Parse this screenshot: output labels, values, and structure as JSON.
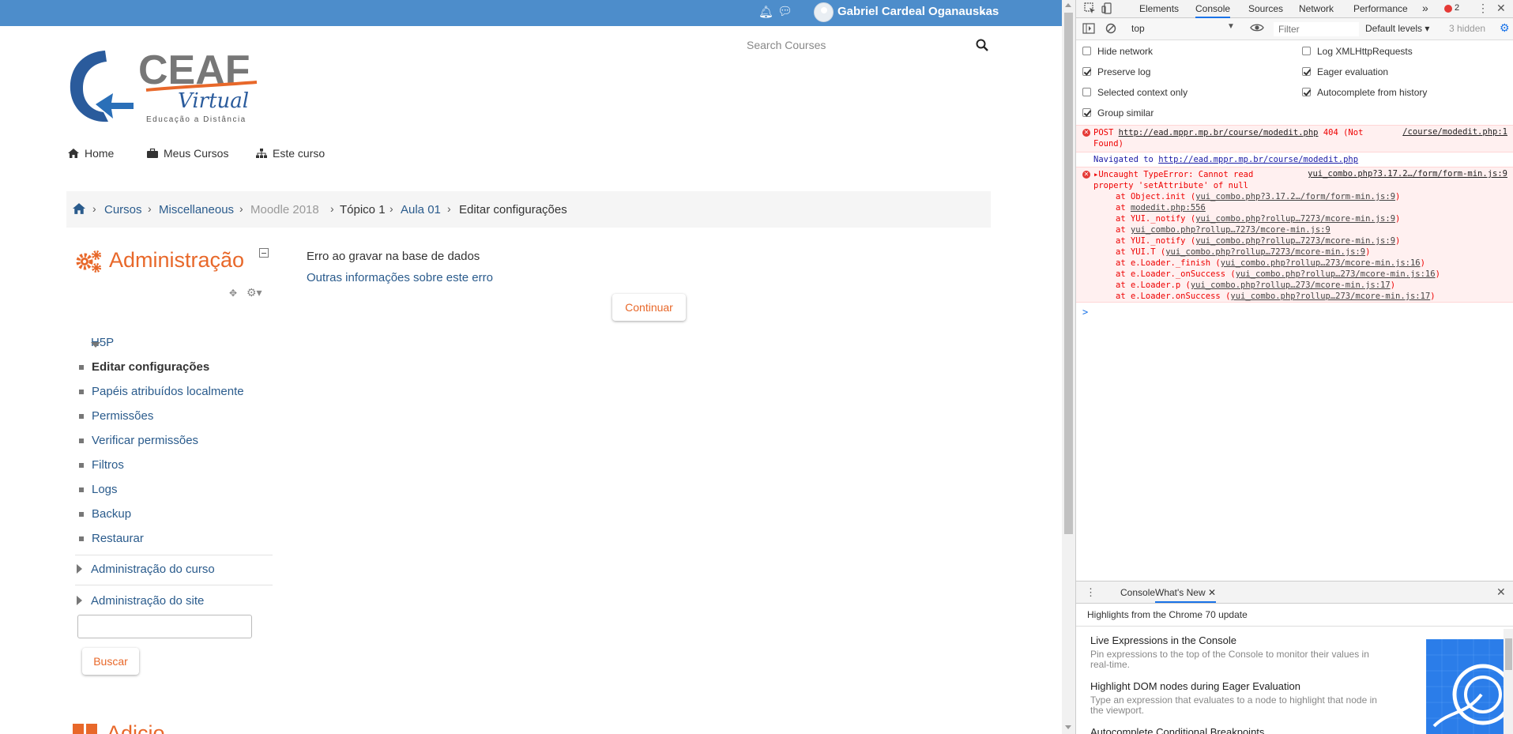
{
  "topbar": {
    "user_name": "Gabriel Cardeal Oganauskas"
  },
  "search": {
    "placeholder": "Search Courses"
  },
  "logo": {
    "brand": "CEAF",
    "script": "Virtual",
    "tagline": "Educação a Distância"
  },
  "nav": {
    "items": [
      "Home",
      "Meus Cursos",
      "Este curso"
    ]
  },
  "breadcrumb": {
    "items": [
      "Cursos",
      "Miscellaneous",
      "Moodle 2018",
      "Tópico 1",
      "Aula 01",
      "Editar configurações"
    ]
  },
  "admin": {
    "title": "Administração",
    "section_open": "H5P",
    "items": [
      "Editar configurações",
      "Papéis atribuídos localmente",
      "Permissões",
      "Verificar permissões",
      "Filtros",
      "Logs",
      "Backup",
      "Restaurar"
    ],
    "sections": [
      "Administração do curso",
      "Administração do site"
    ],
    "search_button": "Buscar",
    "next_block_title": "Adicio"
  },
  "main": {
    "error_message": "Erro ao gravar na base de dados",
    "error_link": "Outras informações sobre este erro",
    "continue_button": "Continuar"
  },
  "devtools": {
    "tabs": [
      "Elements",
      "Console",
      "Sources",
      "Network",
      "Performance"
    ],
    "active_tab": "Console",
    "more": "»",
    "error_count": "2",
    "context": "top",
    "filter_placeholder": "Filter",
    "levels": "Default levels",
    "hidden": "3 hidden",
    "options_left": [
      {
        "label": "Hide network",
        "checked": false
      },
      {
        "label": "Preserve log",
        "checked": true
      },
      {
        "label": "Selected context only",
        "checked": false
      },
      {
        "label": "Group similar",
        "checked": true
      }
    ],
    "options_right": [
      {
        "label": "Log XMLHttpRequests",
        "checked": false
      },
      {
        "label": "Eager evaluation",
        "checked": true
      },
      {
        "label": "Autocomplete from history",
        "checked": true
      }
    ],
    "console": {
      "post_method": "POST",
      "post_url": "http://ead.mppr.mp.br/course/modedit.php",
      "post_status": "404 (Not",
      "post_status2": "Found)",
      "post_source": "/course/modedit.php:1",
      "nav_text": "Navigated to",
      "nav_url": "http://ead.mppr.mp.br/course/modedit.php",
      "error_line1": "Uncaught TypeError: Cannot read",
      "error_line2": "property 'setAttribute' of null",
      "error_source": "yui_combo.php?3.17.2…/form/form-min.js:9",
      "stack": [
        {
          "fn": "at Object.init (",
          "src": "yui_combo.php?3.17.2…/form/form-min.js:9",
          "end": ")"
        },
        {
          "fn": "at ",
          "src": "modedit.php:556",
          "end": ""
        },
        {
          "fn": "at YUI._notify (",
          "src": "yui_combo.php?rollup…7273/mcore-min.js:9",
          "end": ")"
        },
        {
          "fn": "at ",
          "src": "yui_combo.php?rollup…7273/mcore-min.js:9",
          "end": ""
        },
        {
          "fn": "at YUI._notify (",
          "src": "yui_combo.php?rollup…7273/mcore-min.js:9",
          "end": ")"
        },
        {
          "fn": "at YUI.T (",
          "src": "yui_combo.php?rollup…7273/mcore-min.js:9",
          "end": ")"
        },
        {
          "fn": "at e.Loader._finish (",
          "src": "yui_combo.php?rollup…273/mcore-min.js:16",
          "end": ")"
        },
        {
          "fn": "at e.Loader._onSuccess (",
          "src": "yui_combo.php?rollup…273/mcore-min.js:16",
          "end": ")"
        },
        {
          "fn": "at e.Loader.p (",
          "src": "yui_combo.php?rollup…273/mcore-min.js:17",
          "end": ")"
        },
        {
          "fn": "at e.Loader.onSuccess (",
          "src": "yui_combo.php?rollup…273/mcore-min.js:17",
          "end": ")"
        }
      ],
      "prompt": ">"
    },
    "drawer": {
      "tabs": [
        "Console",
        "What's New"
      ],
      "active_tab": "What's New",
      "header": "Highlights from the Chrome 70 update",
      "items": [
        {
          "title": "Live Expressions in the Console",
          "desc": "Pin expressions to the top of the Console to monitor their values in real-time."
        },
        {
          "title": "Highlight DOM nodes during Eager Evaluation",
          "desc": "Type an expression that evaluates to a node to highlight that node in the viewport."
        },
        {
          "title": "Autocomplete Conditional Breakpoints",
          "desc": ""
        }
      ]
    }
  }
}
